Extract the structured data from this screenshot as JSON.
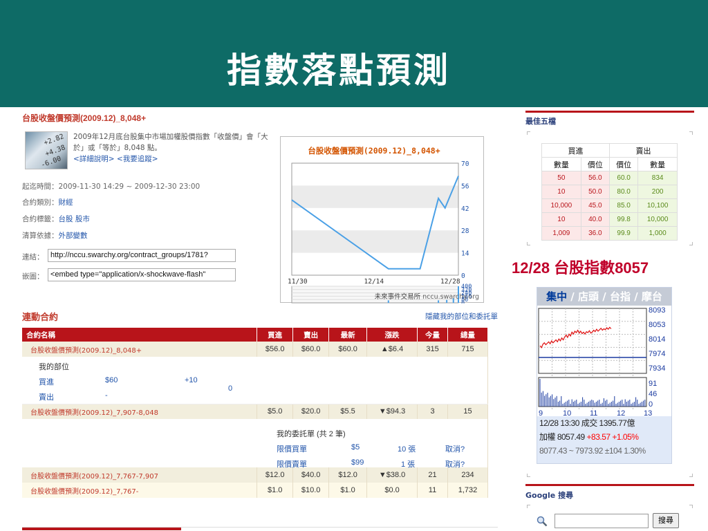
{
  "slide": {
    "title": "指數落點預測"
  },
  "contract": {
    "title": "台股收盤價預測(2009.12)_8,048+",
    "description_1": "2009年12月底台股集中市場加權股價指數「收盤價」會「大於」或「等於」8,048 點。",
    "links": "<詳細說明> <我要追蹤>",
    "period": "起迄時間：2009-11-30 14:29 ~ 2009-12-30 23:00",
    "category_label": "合約類別：",
    "category_value": "財經",
    "tags_label": "合約標籤：",
    "tags_value": "台股 股市",
    "settle_label": "清算依據：",
    "settle_value": "外部變數",
    "link_label": "連結：",
    "link_value": "http://nccu.swarchy.org/contract_groups/1781?",
    "embed_label": "嵌圖：",
    "embed_value": "<embed type=\"application/x-shockwave-flash\"",
    "thumb_numbers": [
      "+2.82",
      "+4.38",
      "-6.00"
    ]
  },
  "chart_data": {
    "type": "line",
    "title": "台股收盤價預測(2009.12)_8,048+",
    "x_ticks": [
      "11/30",
      "12/14",
      "12/28"
    ],
    "y_ticks": [
      0,
      14,
      28,
      42,
      56,
      70
    ],
    "ylim": [
      0,
      70
    ],
    "price_points": [
      [
        0,
        47
      ],
      [
        0.58,
        4
      ],
      [
        0.77,
        4
      ],
      [
        0.88,
        48
      ],
      [
        0.92,
        42
      ],
      [
        1.0,
        62
      ]
    ],
    "volume_ticks": [
      0,
      80,
      160,
      240,
      320,
      400
    ],
    "volume_bars": [
      [
        0.58,
        60
      ],
      [
        0.88,
        60
      ],
      [
        0.93,
        70
      ],
      [
        0.97,
        110
      ],
      [
        1.0,
        400
      ]
    ],
    "source": "未來事件交易所",
    "source_url": "nccu.swarchy.org"
  },
  "linked": {
    "section_title": "連動合約",
    "hide_link": "隱藏我的部位和委託單",
    "headers": [
      "合約名稱",
      "買進",
      "賣出",
      "最新",
      "漲跌",
      "今量",
      "總量"
    ],
    "rows": [
      {
        "name": "台股收盤價預測(2009.12)_8,048+",
        "buy": "$56.0",
        "sell": "$60.0",
        "last": "$60.0",
        "change": "▲$6.4",
        "dir": "up",
        "today": "315",
        "total": "715"
      },
      {
        "name": "台股收盤價預測(2009.12)_7,907-8,048",
        "buy": "$5.0",
        "sell": "$20.0",
        "last": "$5.5",
        "change": "▼$94.3",
        "dir": "down",
        "today": "3",
        "total": "15"
      },
      {
        "name": "台股收盤價預測(2009.12)_7,767-7,907",
        "buy": "$12.0",
        "sell": "$40.0",
        "last": "$12.0",
        "change": "▼$38.0",
        "dir": "down",
        "today": "21",
        "total": "234"
      },
      {
        "name": "台股收盤價預測(2009.12)_7,767-",
        "buy": "$1.0",
        "sell": "$10.0",
        "last": "$1.0",
        "change": "$0.0",
        "dir": "flat",
        "today": "11",
        "total": "1,732"
      }
    ],
    "position": {
      "title": "我的部位",
      "buy_label": "買進",
      "buy_price": "$60",
      "buy_qty": "+10",
      "sell_label": "賣出",
      "sell_price": "-",
      "net": "0"
    },
    "orders": {
      "title": "我的委託單 (共 2 筆)",
      "items": [
        {
          "type": "限價買單",
          "price": "$5",
          "qty": "10 張",
          "action": "取消?"
        },
        {
          "type": "限價賣單",
          "price": "$99",
          "qty": "1 張",
          "action": "取消?"
        }
      ]
    }
  },
  "best5": {
    "title": "最佳五檔",
    "buy_header": "買進",
    "sell_header": "賣出",
    "cols": [
      "數量",
      "價位",
      "價位",
      "數量"
    ],
    "rows": [
      [
        "50",
        "56.0",
        "60.0",
        "834"
      ],
      [
        "10",
        "50.0",
        "80.0",
        "200"
      ],
      [
        "10,000",
        "45.0",
        "85.0",
        "10,100"
      ],
      [
        "10",
        "40.0",
        "99.8",
        "10,000"
      ],
      [
        "1,009",
        "36.0",
        "99.9",
        "1,000"
      ]
    ]
  },
  "index": {
    "label_prefix": "12/28 ",
    "label_text": "台股指數",
    "label_value": "8057",
    "tabs": [
      "集中",
      "店頭",
      "台指",
      "摩台"
    ],
    "y_labels": [
      "8093",
      "8053",
      "8014",
      "7974",
      "7934"
    ],
    "vol_labels": [
      "91",
      "46",
      "0"
    ],
    "x_labels": [
      "9",
      "10",
      "11",
      "12",
      "13"
    ],
    "line1": "12/28  13:30     成交 1395.77億",
    "line2_a": "加權  8057.49  ",
    "line2_b": "+83.57 +1.05%",
    "line3": "8077.43 ~ 7973.92  ±104  1.30%"
  },
  "google": {
    "title": "Google 搜尋",
    "button": "搜尋"
  }
}
